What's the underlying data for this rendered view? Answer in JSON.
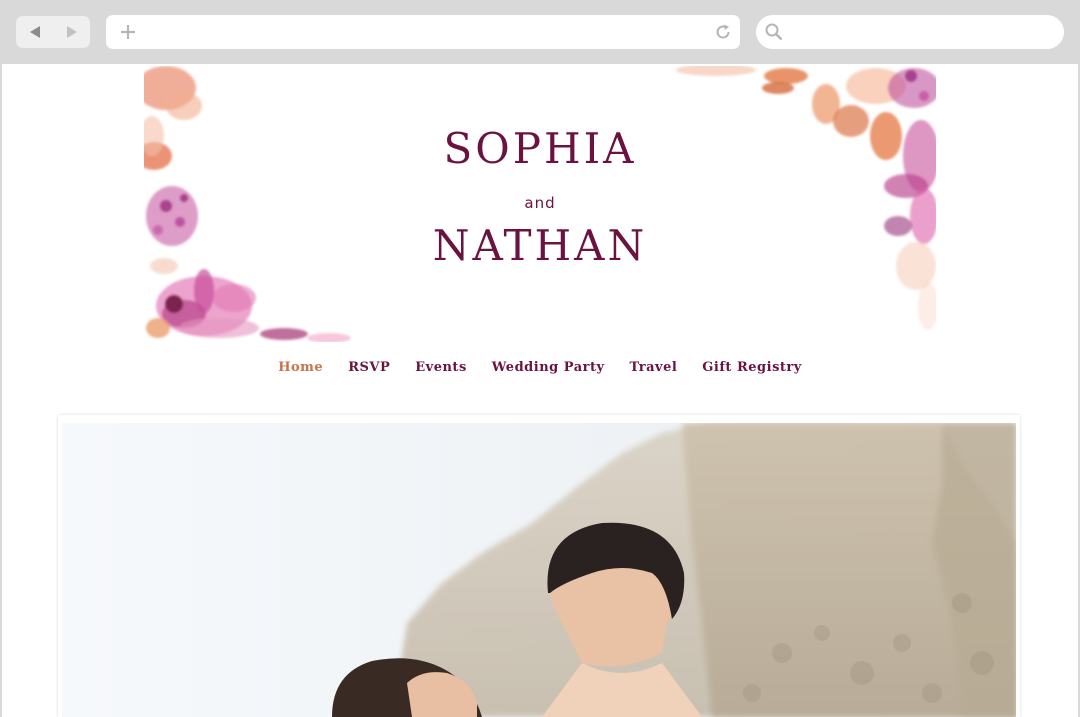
{
  "browser": {
    "back_icon": "back-arrow-icon",
    "forward_icon": "forward-arrow-icon",
    "address_placeholder": "",
    "search_placeholder": ""
  },
  "site": {
    "name_one": "SOPHIA",
    "conjunction": "and",
    "name_two": "NATHAN",
    "colors": {
      "primary": "#6a1340",
      "active": "#c9734a"
    }
  },
  "nav": {
    "items": [
      {
        "label": "Home",
        "active": true
      },
      {
        "label": "RSVP",
        "active": false
      },
      {
        "label": "Events",
        "active": false
      },
      {
        "label": "Wedding Party",
        "active": false
      },
      {
        "label": "Travel",
        "active": false
      },
      {
        "label": "Gift Registry",
        "active": false
      }
    ]
  }
}
